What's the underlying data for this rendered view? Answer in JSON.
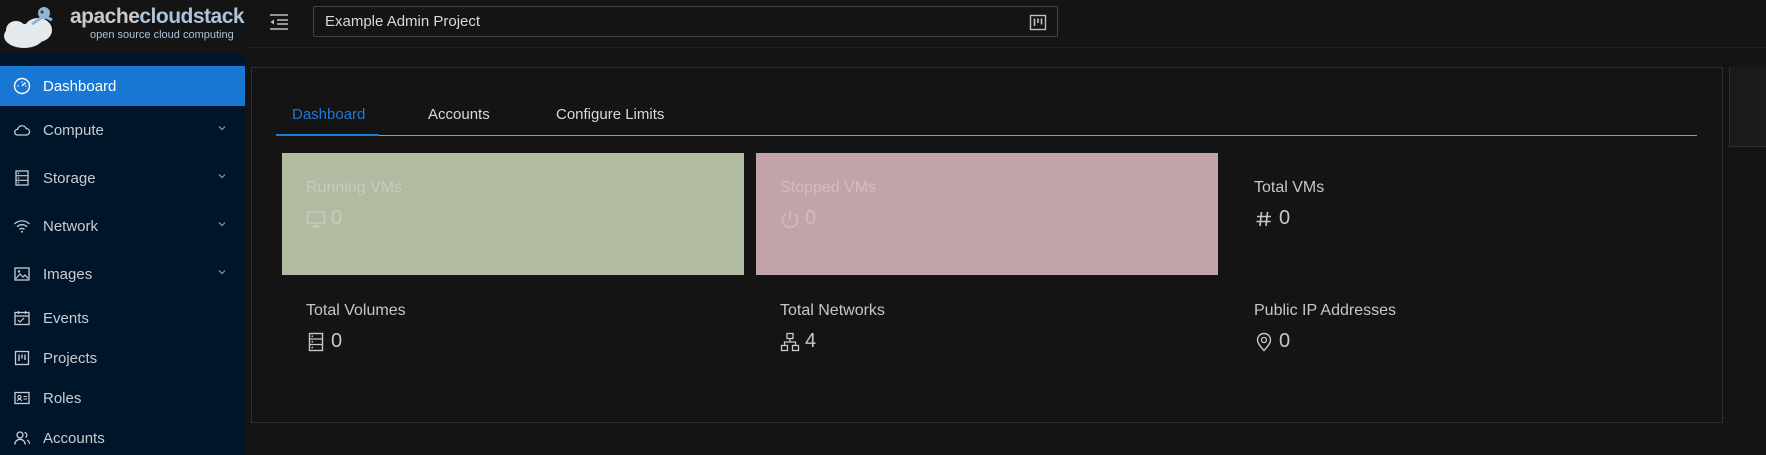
{
  "logo": {
    "brand_part1": "apache",
    "brand_part2": "cloudstack",
    "tagline": "open source cloud computing"
  },
  "header": {
    "project_name": "Example Admin Project"
  },
  "sidebar": {
    "items": [
      {
        "label": "Dashboard",
        "icon": "dashboard-icon",
        "active": true
      },
      {
        "label": "Compute",
        "icon": "cloud-icon",
        "has_children": true
      },
      {
        "label": "Storage",
        "icon": "storage-icon",
        "has_children": true
      },
      {
        "label": "Network",
        "icon": "wifi-icon",
        "has_children": true
      },
      {
        "label": "Images",
        "icon": "picture-icon",
        "has_children": true
      },
      {
        "label": "Events",
        "icon": "schedule-icon"
      },
      {
        "label": "Projects",
        "icon": "project-icon"
      },
      {
        "label": "Roles",
        "icon": "idcard-icon"
      },
      {
        "label": "Accounts",
        "icon": "team-icon"
      }
    ]
  },
  "tabs": [
    {
      "label": "Dashboard",
      "active": true
    },
    {
      "label": "Accounts"
    },
    {
      "label": "Configure Limits"
    }
  ],
  "stats": {
    "running_vms": {
      "title": "Running VMs",
      "value": "0",
      "icon": "desktop-icon",
      "color": "#b0bba1"
    },
    "stopped_vms": {
      "title": "Stopped VMs",
      "value": "0",
      "icon": "poweroff-icon",
      "color": "#c2a4a8"
    },
    "total_vms": {
      "title": "Total VMs",
      "value": "0",
      "icon": "number-icon"
    },
    "total_volumes": {
      "title": "Total Volumes",
      "value": "0",
      "icon": "database-icon"
    },
    "total_networks": {
      "title": "Total Networks",
      "value": "4",
      "icon": "apartment-icon"
    },
    "public_ips": {
      "title": "Public IP Addresses",
      "value": "0",
      "icon": "environment-icon"
    }
  },
  "colors": {
    "accent": "#1777d3",
    "sidebar_bg": "#001529",
    "page_bg": "#141414"
  }
}
